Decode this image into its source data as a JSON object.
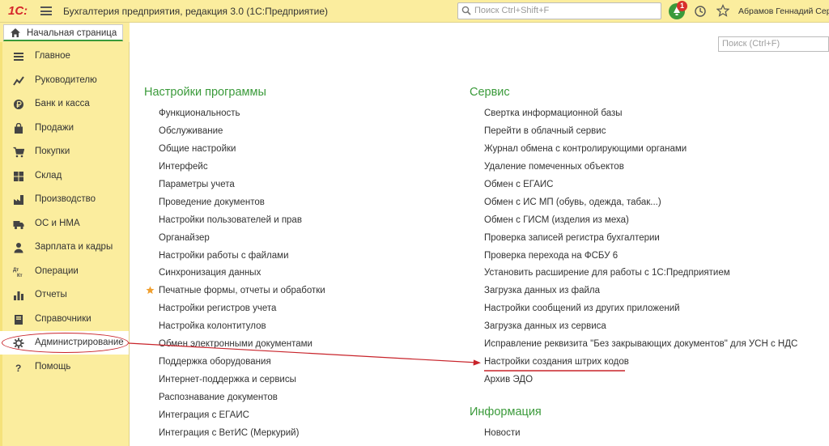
{
  "titlebar": {
    "logo": "1С:",
    "title": "Бухгалтерия предприятия, редакция 3.0  (1С:Предприятие)",
    "search_placeholder": "Поиск Ctrl+Shift+F",
    "notifications_count": "1",
    "user": "Абрамов Геннадий Сергеевич"
  },
  "home_tab": {
    "label": "Начальная страница"
  },
  "sidebar": {
    "items": [
      {
        "label": "Главное",
        "icon": "menu-icon"
      },
      {
        "label": "Руководителю",
        "icon": "chart-line-icon"
      },
      {
        "label": "Банк и касса",
        "icon": "ruble-coin-icon"
      },
      {
        "label": "Продажи",
        "icon": "shopping-bag-icon"
      },
      {
        "label": "Покупки",
        "icon": "cart-icon"
      },
      {
        "label": "Склад",
        "icon": "warehouse-icon"
      },
      {
        "label": "Производство",
        "icon": "factory-icon"
      },
      {
        "label": "ОС и НМА",
        "icon": "truck-icon"
      },
      {
        "label": "Зарплата и кадры",
        "icon": "person-icon"
      },
      {
        "label": "Операции",
        "icon": "debit-credit-icon",
        "icon_text": "Дт Кт"
      },
      {
        "label": "Отчеты",
        "icon": "bar-chart-icon"
      },
      {
        "label": "Справочники",
        "icon": "book-icon"
      },
      {
        "label": "Администрирование",
        "icon": "gear-icon",
        "active": true
      },
      {
        "label": "Помощь",
        "icon": "help-icon",
        "icon_text": "?"
      }
    ]
  },
  "content": {
    "search_placeholder": "Поиск (Ctrl+F)",
    "settings": {
      "title": "Настройки программы",
      "links": [
        "Функциональность",
        "Обслуживание",
        "Общие настройки",
        "Интерфейс",
        "Параметры учета",
        "Проведение документов",
        "Настройки пользователей и прав",
        "Органайзер",
        "Настройки работы с файлами",
        "Синхронизация данных",
        "Печатные формы, отчеты и обработки",
        "Настройки регистров учета",
        "Настройка колонтитулов",
        "Обмен электронными документами",
        "Поддержка оборудования",
        "Интернет-поддержка и сервисы",
        "Распознавание документов",
        "Интеграция с ЕГАИС",
        "Интеграция с ВетИС (Меркурий)"
      ]
    },
    "service": {
      "title": "Сервис",
      "links": [
        "Свертка информационной базы",
        "Перейти в облачный сервис",
        "Журнал обмена с контролирующими органами",
        "Удаление помеченных объектов",
        "Обмен с ЕГАИС",
        "Обмен с ИС МП (обувь, одежда, табак...)",
        "Обмен с ГИСМ (изделия из меха)",
        "Проверка записей регистра бухгалтерии",
        "Проверка перехода на ФСБУ 6",
        "Установить расширение для работы с 1С:Предприятием",
        "Загрузка данных из файла",
        "Настройки сообщений из других приложений",
        "Загрузка данных из сервиса",
        "Исправление реквизита \"Без закрывающих документов\" для УСН с НДС",
        "Настройки создания штрих кодов",
        "Архив ЭДО"
      ]
    },
    "info": {
      "title": "Информация",
      "links": [
        "Новости"
      ]
    }
  },
  "colors": {
    "panel_bg": "#fbed9e",
    "section_title": "#3a9a3a",
    "annotation_red": "#c8232a"
  }
}
